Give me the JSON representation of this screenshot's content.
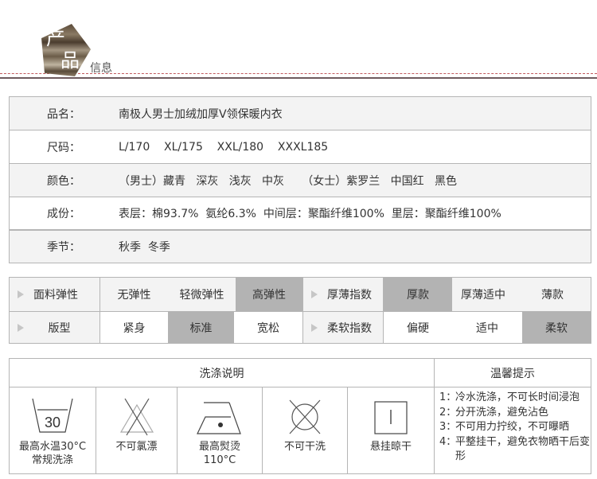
{
  "header": {
    "title_char1": "产",
    "title_char2": "品",
    "title_rest": "信息",
    "accent_color": "#c25a5e",
    "line_color": "#6e5a5e"
  },
  "info": {
    "rows": [
      {
        "label": "品名：",
        "value": "南极人男士加绒加厚V领保暖内衣"
      },
      {
        "label": "尺码：",
        "value": "L/170    XL/175    XXL/180    XXXL185"
      },
      {
        "label": "颜色：",
        "value": "（男士）藏青   深灰   浅灰   中灰     （女士）紫罗兰   中国红   黑色"
      },
      {
        "label": "成份：",
        "value": "表层：棉93.7%  氨纶6.3%  中间层：聚酯纤维100%  里层：聚酯纤维100%"
      },
      {
        "label": "季节：",
        "value": "秋季  冬季"
      }
    ]
  },
  "attributes": {
    "selected_color": "#b3b3b3",
    "elasticity": {
      "label": "面料弹性",
      "options": [
        "无弹性",
        "轻微弹性",
        "高弹性"
      ],
      "selected": "高弹性"
    },
    "thickness": {
      "label": "厚薄指数",
      "options": [
        "厚款",
        "厚薄适中",
        "薄款"
      ],
      "selected": "厚款"
    },
    "fit": {
      "label": "版型",
      "options": [
        "紧身",
        "标准",
        "宽松"
      ],
      "selected": "标准"
    },
    "softness": {
      "label": "柔软指数",
      "options": [
        "偏硬",
        "适中",
        "柔软"
      ],
      "selected": "柔软"
    }
  },
  "wash": {
    "title": "洗涤说明",
    "items": [
      {
        "icon": "wash-30-icon",
        "icon_text": "30",
        "caption": "最高水温30°C\n常规洗涤"
      },
      {
        "icon": "no-bleach-icon",
        "caption": "不可氯漂"
      },
      {
        "icon": "iron-110-icon",
        "caption": "最高熨烫\n110°C"
      },
      {
        "icon": "no-dry-clean-icon",
        "caption": "不可干洗"
      },
      {
        "icon": "line-dry-icon",
        "caption": "悬挂晾干"
      }
    ]
  },
  "tips": {
    "title": "温馨提示",
    "items": [
      {
        "num": "1：",
        "text": "冷水洗涤，不可长时间浸泡"
      },
      {
        "num": "2：",
        "text": "分开洗涤，避免沾色"
      },
      {
        "num": "3：",
        "text": "不可用力拧绞，不可曝晒"
      },
      {
        "num": "4：",
        "text": "平整挂干，避免衣物晒干后变形"
      }
    ]
  }
}
